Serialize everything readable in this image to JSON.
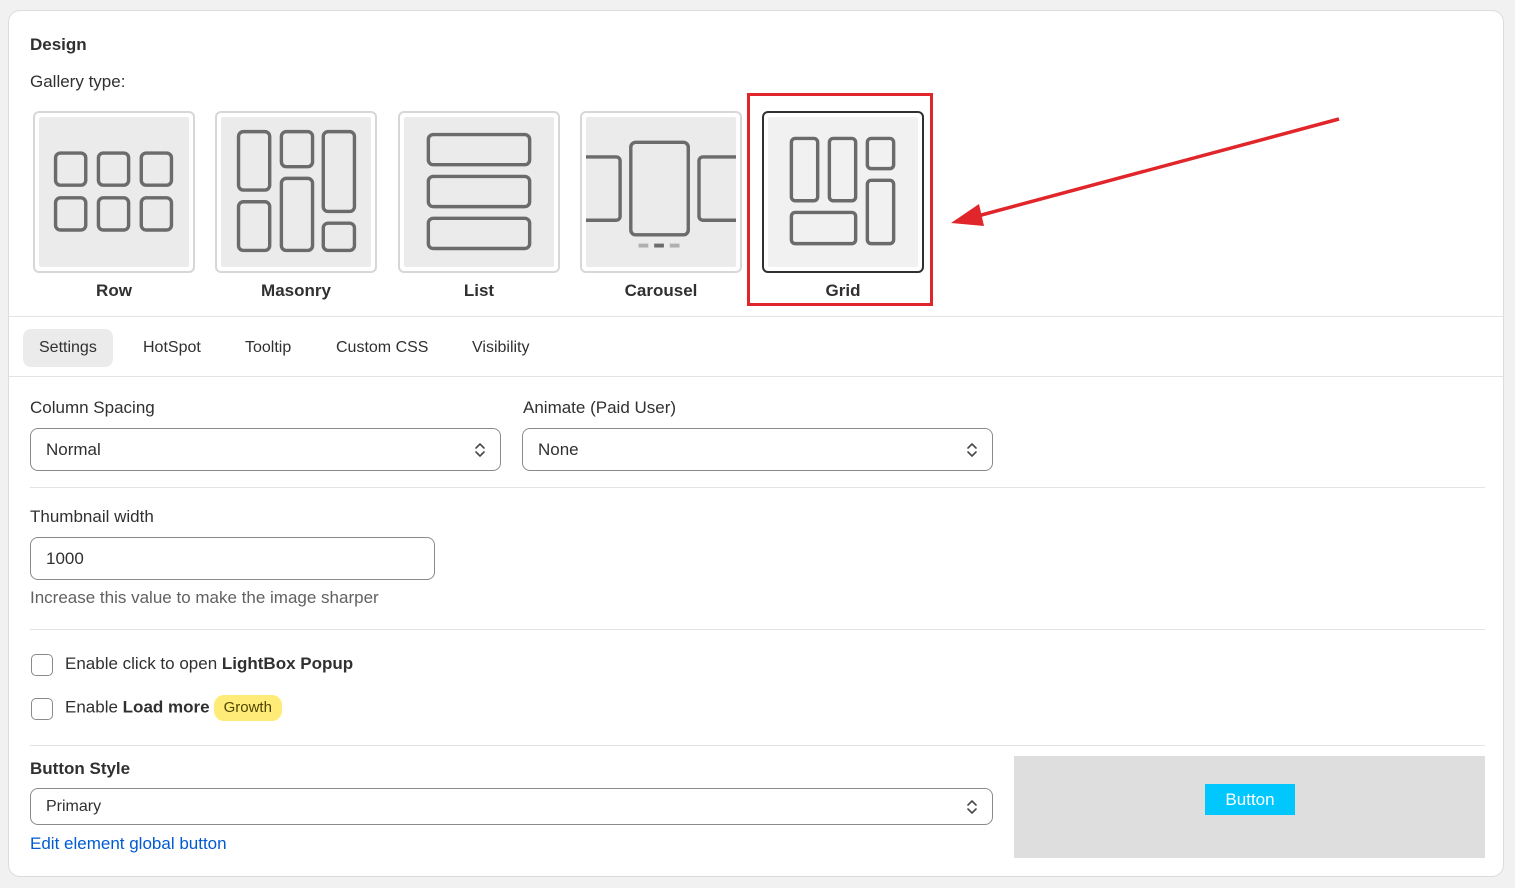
{
  "design": {
    "title": "Design",
    "gallery_type_label": "Gallery type:",
    "gallery_types": [
      {
        "label": "Row",
        "icon": "row-layout-icon",
        "selected": false
      },
      {
        "label": "Masonry",
        "icon": "masonry-layout-icon",
        "selected": false
      },
      {
        "label": "List",
        "icon": "list-layout-icon",
        "selected": false
      },
      {
        "label": "Carousel",
        "icon": "carousel-layout-icon",
        "selected": false
      },
      {
        "label": "Grid",
        "icon": "grid-layout-icon",
        "selected": true
      }
    ]
  },
  "tabs": [
    {
      "label": "Settings",
      "active": true
    },
    {
      "label": "HotSpot",
      "active": false
    },
    {
      "label": "Tooltip",
      "active": false
    },
    {
      "label": "Custom CSS",
      "active": false
    },
    {
      "label": "Visibility",
      "active": false
    }
  ],
  "settings": {
    "column_spacing": {
      "label": "Column Spacing",
      "value": "Normal"
    },
    "animate": {
      "label": "Animate (Paid User)",
      "value": "None"
    },
    "thumbnail_width": {
      "label": "Thumbnail width",
      "value": "1000",
      "help": "Increase this value to make the image sharper"
    },
    "lightbox": {
      "prefix": "Enable click to open ",
      "bold": "LightBox Popup",
      "checked": false
    },
    "load_more": {
      "prefix": "Enable ",
      "bold": "Load more",
      "badge": "Growth",
      "checked": false
    },
    "button_style": {
      "label": "Button Style",
      "value": "Primary",
      "link": "Edit element global button"
    },
    "preview_button_label": "Button"
  },
  "colors": {
    "highlight": "#e0262a",
    "link": "#005bd3",
    "badge_bg": "#ffeb78",
    "preview_button_bg": "#00c8ff"
  }
}
